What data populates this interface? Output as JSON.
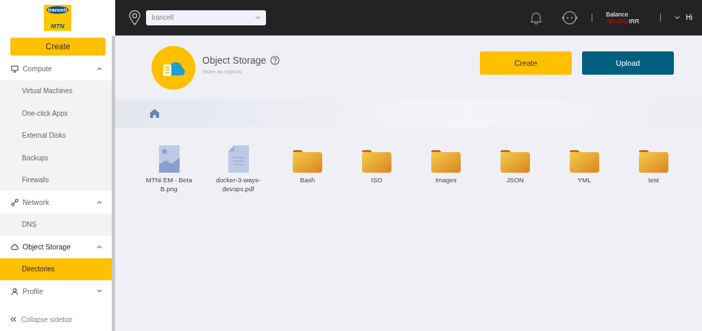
{
  "logo": {
    "top": "Irancell",
    "bottom": "MTN"
  },
  "sidebar": {
    "create_button": "Create",
    "groups": [
      {
        "label": "Compute",
        "kind": "monitor",
        "expanded": true,
        "children": [
          {
            "label": "Virtual Machines",
            "selected": false
          },
          {
            "label": "One-click Apps",
            "selected": false
          },
          {
            "label": "External Disks",
            "selected": false
          },
          {
            "label": "Backups",
            "selected": false
          },
          {
            "label": "Firewalls",
            "selected": false
          }
        ]
      },
      {
        "label": "Network",
        "kind": "network",
        "expanded": true,
        "children": [
          {
            "label": "DNS",
            "selected": false
          }
        ]
      },
      {
        "label": "Object Storage",
        "kind": "storage",
        "expanded": true,
        "children": [
          {
            "label": "Directories",
            "selected": true
          }
        ]
      },
      {
        "label": "Profile",
        "kind": "user",
        "expanded": false
      }
    ],
    "collapse": "Collapse sidebar"
  },
  "topbar": {
    "region": "Irancell",
    "balance_label": "Balance",
    "balance_value": "-90,693",
    "currency": "IRR",
    "greeting": "Hi"
  },
  "header": {
    "title": "Object Storage",
    "subtitle": "Store as objects",
    "buttons": [
      {
        "label": "Create",
        "kind": "primary"
      },
      {
        "label": "Upload",
        "kind": "secondary"
      }
    ]
  },
  "files": [
    {
      "name": "MTNi EM - Beta B.png",
      "kind": "image"
    },
    {
      "name": "docker-3-ways-devops.pdf",
      "kind": "pdf"
    },
    {
      "name": "Bash",
      "kind": "folder"
    },
    {
      "name": "ISO",
      "kind": "folder"
    },
    {
      "name": "Images",
      "kind": "folder"
    },
    {
      "name": "JSON",
      "kind": "folder"
    },
    {
      "name": "YML",
      "kind": "folder"
    },
    {
      "name": "test",
      "kind": "folder"
    }
  ]
}
